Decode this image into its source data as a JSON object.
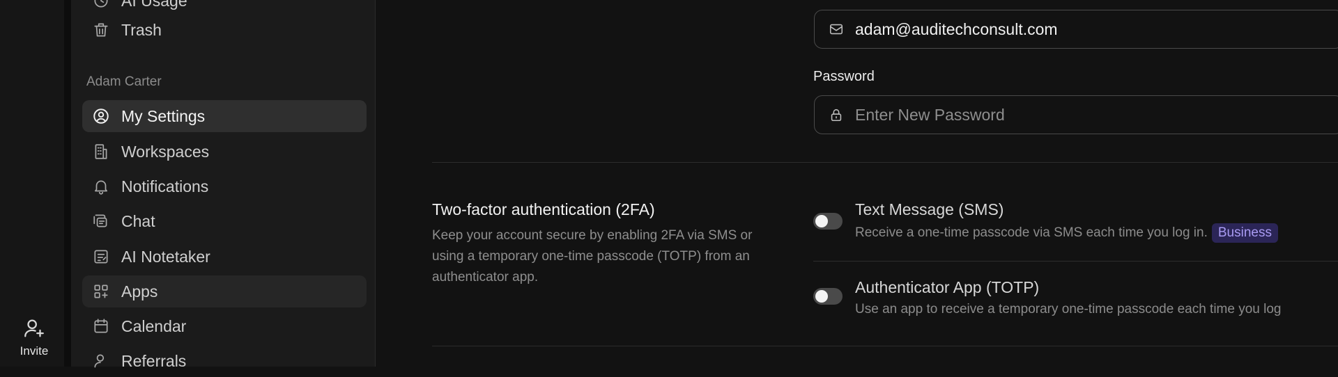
{
  "rail": {
    "invite_label": "Invite"
  },
  "sidebar": {
    "items_top": [
      {
        "label": "AI Usage",
        "icon": "ai-usage-icon"
      },
      {
        "label": "Trash",
        "icon": "trash-icon"
      }
    ],
    "section_label": "Adam Carter",
    "items": [
      {
        "label": "My Settings",
        "icon": "user-circle-icon",
        "active": true
      },
      {
        "label": "Workspaces",
        "icon": "building-icon"
      },
      {
        "label": "Notifications",
        "icon": "bell-icon"
      },
      {
        "label": "Chat",
        "icon": "chat-icon"
      },
      {
        "label": "AI Notetaker",
        "icon": "notetaker-icon"
      },
      {
        "label": "Apps",
        "icon": "apps-grid-icon",
        "hover": true
      },
      {
        "label": "Calendar",
        "icon": "calendar-icon"
      },
      {
        "label": "Referrals",
        "icon": "referrals-icon"
      }
    ]
  },
  "account": {
    "email_value": "adam@auditechconsult.com",
    "password_label": "Password",
    "password_placeholder": "Enter New Password"
  },
  "twofa": {
    "title": "Two-factor authentication (2FA)",
    "description": "Keep your account secure by enabling 2FA via SMS or using a temporary one-time passcode (TOTP) from an authenticator app.",
    "options": [
      {
        "title": "Text Message (SMS)",
        "description": "Receive a one-time passcode via SMS each time you log in.",
        "badge": "Business",
        "enabled": false
      },
      {
        "title": "Authenticator App (TOTP)",
        "description": "Use an app to receive a temporary one-time passcode each time you log",
        "enabled": false
      }
    ]
  },
  "colors": {
    "background": "#121212",
    "sidebar": "#1b1b1b",
    "active_item": "#2f2f2f",
    "badge_bg": "#2b2557",
    "badge_text": "#a99bf3"
  }
}
